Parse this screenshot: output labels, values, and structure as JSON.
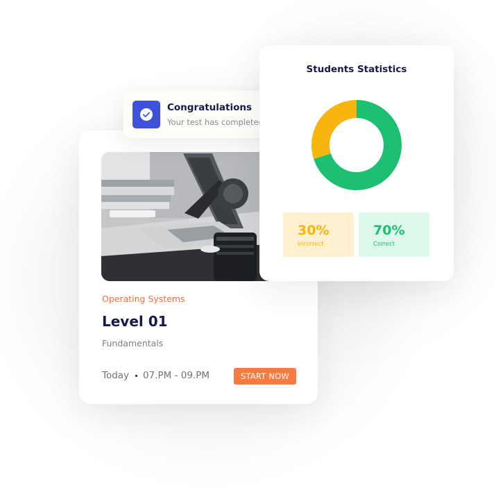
{
  "course": {
    "category": "Operating Systems",
    "title": "Level 01",
    "subtitle": "Fundamentals",
    "day": "Today",
    "time": "07.PM - 09.PM",
    "button_label": "START NOW",
    "accent_color": "#f26c3a",
    "button_color": "#fb7a42"
  },
  "toast": {
    "icon": "check-circle-icon",
    "icon_color": "#3f51d9",
    "title": "Congratulations",
    "message": "Your test has completed"
  },
  "stats": {
    "title": "Students Statistics",
    "incorrect": {
      "value": "30%",
      "label": "Incorrect",
      "color": "#f8b40f",
      "bg_color": "#fff1cf"
    },
    "correct": {
      "value": "70%",
      "label": "Correct",
      "color": "#1cc070",
      "bg_color": "#dcf9ec"
    }
  },
  "chart_data": {
    "type": "pie",
    "categories": [
      "Incorrect",
      "Correct"
    ],
    "values": [
      30,
      70
    ],
    "colors": [
      "#f8b40f",
      "#1cc070"
    ]
  }
}
